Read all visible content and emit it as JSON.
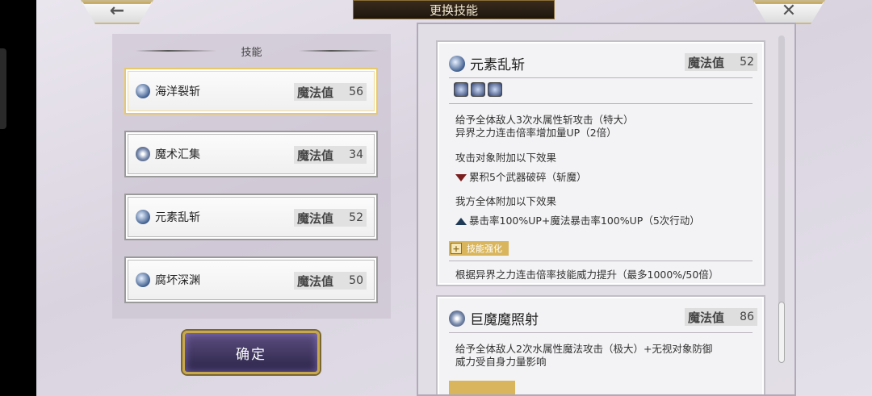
{
  "header": {
    "title": "更换技能",
    "back_icon": "←",
    "close_icon": "✕"
  },
  "skills_panel": {
    "heading": "技能",
    "items": [
      {
        "name": "海洋裂斩",
        "mp_label": "魔法值",
        "mp": "56",
        "icon": "water-slash-icon",
        "selected": true
      },
      {
        "name": "魔术汇集",
        "mp_label": "魔法值",
        "mp": "34",
        "icon": "magic-gather-icon",
        "selected": false
      },
      {
        "name": "元素乱斩",
        "mp_label": "魔法值",
        "mp": "52",
        "icon": "water-slash-icon",
        "selected": false
      },
      {
        "name": "腐坏深渊",
        "mp_label": "魔法值",
        "mp": "50",
        "icon": "water-slash-icon",
        "selected": false
      }
    ],
    "confirm_label": "确定"
  },
  "details": [
    {
      "name": "元素乱斩",
      "mp_label": "魔法值",
      "mp": "52",
      "tags": [
        "claw-tag-icon",
        "star-tag-icon",
        "swirl-tag-icon"
      ],
      "desc1": "给予全体敌人3次水属性斩攻击（特大）",
      "desc2": "异界之力连击倍率增加量UP（2倍）",
      "enemy_effect_header": "攻击对象附加以下效果",
      "enemy_effect": "累积5个武器破碎（斩魔）",
      "ally_effect_header": "我方全体附加以下效果",
      "ally_effect": "暴击率100%UP+魔法暴击率100%UP（5次行动）",
      "enhance_label": "技能强化",
      "enhance_desc": "根据异界之力连击倍率技能威力提升（最多1000%/50倍）"
    },
    {
      "name": "巨魔魔照射",
      "mp_label": "魔法值",
      "mp": "86",
      "desc1": "给予全体敌人2次水属性魔法攻击（极大）+无视对象防御",
      "desc2": "威力受自身力量影响"
    }
  ],
  "colors": {
    "accent_gold": "#d9b65d",
    "title_bg": "#2c2014",
    "confirm_bg": "#3f3562"
  }
}
